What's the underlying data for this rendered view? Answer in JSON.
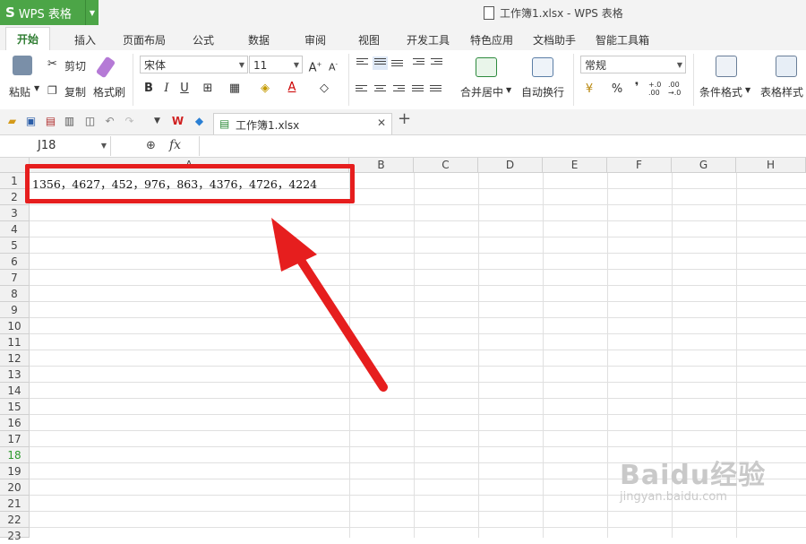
{
  "app": {
    "logo": "S",
    "name": "WPS 表格",
    "window_title": "工作簿1.xlsx - WPS 表格"
  },
  "menu_tabs": [
    "开始",
    "插入",
    "页面布局",
    "公式",
    "数据",
    "审阅",
    "视图",
    "开发工具",
    "特色应用",
    "文档助手",
    "智能工具箱"
  ],
  "ribbon": {
    "paste": "粘贴",
    "cut": "剪切",
    "copy": "复制",
    "format_painter": "格式刷",
    "font_name": "宋体",
    "font_size": "11",
    "merge_center": "合并居中",
    "wrap_text": "自动换行",
    "number_format": "常规",
    "conditional_format": "条件格式",
    "table_style": "表格样式",
    "percent": "%",
    "comma": "❜",
    "inc_decimal": "+.0 .00",
    "dec_decimal": ".00 →.0"
  },
  "file_tab": {
    "name": "工作簿1.xlsx"
  },
  "formula_bar": {
    "cell_ref": "J18",
    "fx": "fx"
  },
  "columns": [
    "A",
    "B",
    "C",
    "D",
    "E",
    "F",
    "G",
    "H"
  ],
  "rows": [
    "1",
    "2",
    "3",
    "4",
    "5",
    "6",
    "7",
    "8",
    "9",
    "10",
    "11",
    "12",
    "13",
    "14",
    "15",
    "16",
    "17",
    "18",
    "19",
    "20",
    "21",
    "22",
    "23"
  ],
  "selected_row": "18",
  "cells": {
    "A1": "1356，4627，452，976，863，4376，4726，4224"
  },
  "watermark": {
    "brand": "Baidu经验",
    "url": "jingyan.baidu.com"
  },
  "colors": {
    "accent": "#4ca547",
    "highlight": "#e61e1e"
  }
}
